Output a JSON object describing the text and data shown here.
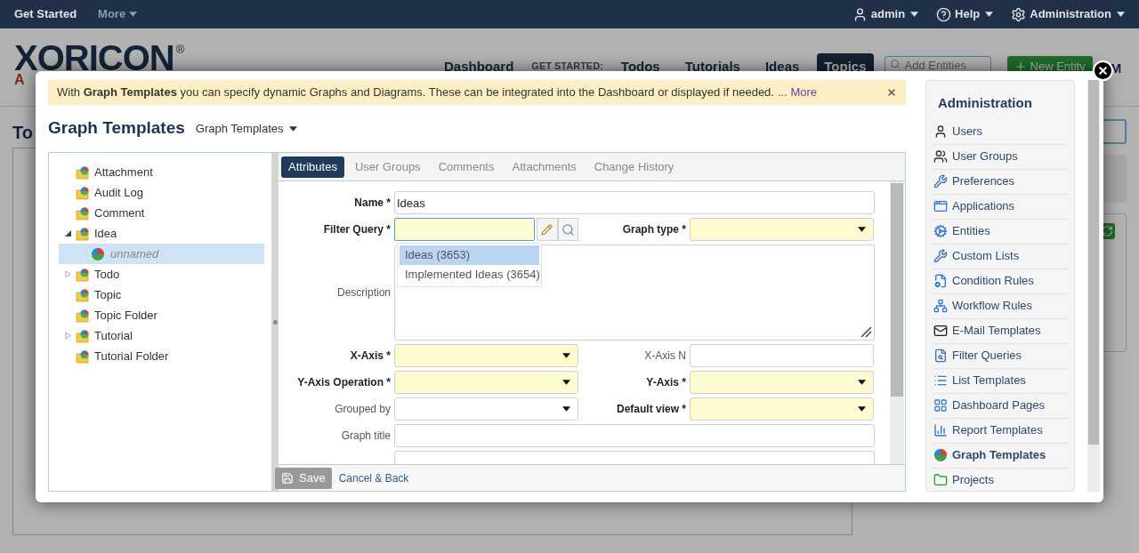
{
  "top_bar": {
    "left": [
      {
        "label": "Get Started",
        "dropdown": false
      },
      {
        "label": "More",
        "dropdown": true
      }
    ],
    "right": [
      {
        "label": "admin",
        "dropdown": true
      },
      {
        "label": "Help",
        "dropdown": true
      },
      {
        "label": "Administration",
        "dropdown": true
      }
    ]
  },
  "header": {
    "logo": {
      "wordmark": "XORICON",
      "mark": "®",
      "subline": "A"
    },
    "nav": [
      {
        "label": "Dashboard",
        "kind": "link",
        "selected": false
      },
      {
        "label": "GET STARTED:",
        "kind": "heading",
        "selected": false
      },
      {
        "label": "Todos",
        "kind": "link",
        "selected": false
      },
      {
        "label": "Tutorials",
        "kind": "link",
        "selected": false
      },
      {
        "label": "Ideas",
        "kind": "link",
        "selected": false
      },
      {
        "label": "Topics",
        "kind": "link",
        "selected": true
      }
    ],
    "search": {
      "placeholder": "Add Entities"
    },
    "new_button": "New Entity",
    "more_menu": "M"
  },
  "page": {
    "title": "To"
  },
  "modal": {
    "banner": {
      "text": "With **Graph Templates** you can specify dynamic Graphs and Diagrams. These can be integrated into the Dashboard or displayed if needed.",
      "link": "... More"
    },
    "title": "Graph Templates",
    "view_switch": {
      "label": "Graph Templates",
      "dropdown": true
    },
    "tree": [
      {
        "label": "Attachment",
        "kind": "entity",
        "selected": false
      },
      {
        "label": "Audit Log",
        "kind": "entity",
        "selected": false
      },
      {
        "label": "Comment",
        "kind": "entity",
        "selected": false
      },
      {
        "label": "Idea",
        "kind": "entity",
        "expanded": true,
        "selected": false,
        "children": [
          {
            "label": "unnamed",
            "kind": "graph",
            "selected": true
          }
        ]
      },
      {
        "label": "Todo",
        "kind": "entity",
        "expanded": false,
        "selected": false
      },
      {
        "label": "Topic",
        "kind": "entity",
        "selected": false
      },
      {
        "label": "Topic Folder",
        "kind": "entity",
        "selected": false
      },
      {
        "label": "Tutorial",
        "kind": "entity",
        "expanded": false,
        "selected": false
      },
      {
        "label": "Tutorial Folder",
        "kind": "entity",
        "selected": false
      }
    ],
    "tabs": [
      {
        "label": "Attributes",
        "selected": true
      },
      {
        "label": "User Groups",
        "selected": false
      },
      {
        "label": "Comments",
        "selected": false
      },
      {
        "label": "Attachments",
        "selected": false
      },
      {
        "label": "Change History",
        "selected": false
      }
    ],
    "form": {
      "rows": [
        [
          {
            "label": "Name *",
            "required": true,
            "kind": "text",
            "value": "Ideas",
            "focused": false
          }
        ],
        [
          {
            "label": "Filter Query *",
            "required": true,
            "kind": "query",
            "focused": true,
            "suggestions": [
              {
                "label": "Ideas (3653)",
                "selected": true
              },
              {
                "label": "Implemented Ideas (3654)",
                "selected": false
              }
            ]
          },
          {
            "label": "Graph type *",
            "required": true,
            "kind": "select",
            "focused": false
          }
        ],
        [
          {
            "label": "Description",
            "required": false,
            "kind": "textarea",
            "focused": false
          }
        ],
        [
          {
            "label": "X-Axis *",
            "required": true,
            "kind": "select",
            "focused": false
          },
          {
            "label": "X-Axis N",
            "required": false,
            "kind": "text",
            "focused": false
          }
        ],
        [
          {
            "label": "Y-Axis Operation *",
            "required": true,
            "kind": "select",
            "focused": false
          },
          {
            "label": "Y-Axis *",
            "required": true,
            "kind": "select",
            "focused": false
          }
        ],
        [
          {
            "label": "Grouped by",
            "required": false,
            "kind": "select",
            "focused": false
          },
          {
            "label": "Default view *",
            "required": true,
            "kind": "select",
            "focused": false
          }
        ],
        [
          {
            "label": "Graph title",
            "required": false,
            "kind": "text",
            "focused": false
          }
        ],
        [
          {
            "kind": "text",
            "focused": false
          }
        ]
      ]
    },
    "footer": {
      "save": "Save",
      "cancel": "Cancel & Back"
    },
    "admin": {
      "title": "Administration",
      "items": [
        {
          "label": "Users",
          "selected": false
        },
        {
          "label": "User Groups",
          "selected": false
        },
        {
          "label": "Preferences",
          "selected": false
        },
        {
          "label": "Applications",
          "selected": false
        },
        {
          "label": "Entities",
          "selected": false
        },
        {
          "label": "Custom Lists",
          "selected": false
        },
        {
          "label": "Condition Rules",
          "selected": false
        },
        {
          "label": "Workflow Rules",
          "selected": false
        },
        {
          "label": "E-Mail Templates",
          "selected": false
        },
        {
          "label": "Filter Queries",
          "selected": false
        },
        {
          "label": "List Templates",
          "selected": false
        },
        {
          "label": "Dashboard Pages",
          "selected": false
        },
        {
          "label": "Report Templates",
          "selected": false
        },
        {
          "label": "Graph Templates",
          "selected": true
        },
        {
          "label": "Projects",
          "selected": false
        }
      ]
    }
  }
}
